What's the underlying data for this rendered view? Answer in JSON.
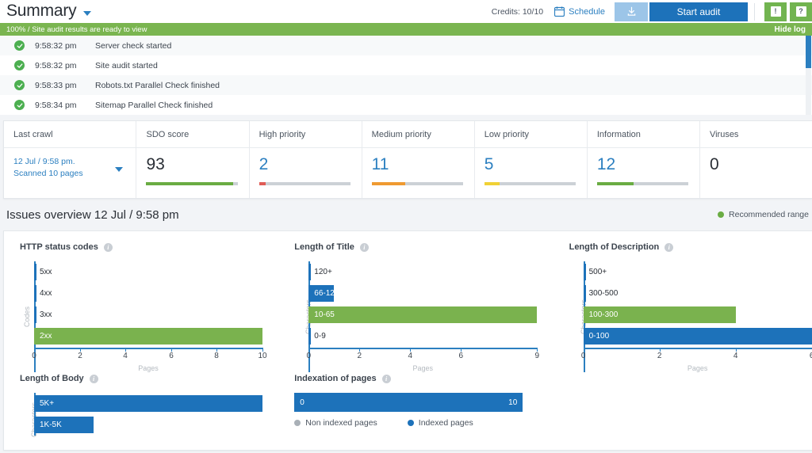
{
  "header": {
    "title": "Summary",
    "credits": "Credits: 10/10",
    "schedule_label": "Schedule",
    "export_icon": "export-icon",
    "start_audit_label": "Start audit",
    "feedback_glyph": "!",
    "help_glyph": "?"
  },
  "logbar": {
    "status": "100% / Site audit results are ready to view",
    "hide_log_label": "Hide log"
  },
  "log_rows": [
    {
      "time": "9:58:32 pm",
      "message": "Server check started"
    },
    {
      "time": "9:58:32 pm",
      "message": "Site audit started"
    },
    {
      "time": "9:58:33 pm",
      "message": "Robots.txt Parallel Check finished"
    },
    {
      "time": "9:58:34 pm",
      "message": "Sitemap Parallel Check finished"
    }
  ],
  "summary": {
    "columns": [
      {
        "header": "Last crawl",
        "line1": "12 Jul / 9:58 pm.",
        "line2": "Scanned 10 pages"
      },
      {
        "header": "SDO score",
        "value": "93",
        "meter_pct": 95,
        "meter_color": "#6aac43",
        "value_color": "dark"
      },
      {
        "header": "High priority",
        "value": "2",
        "meter_pct": 7,
        "meter_color": "#e05c56",
        "value_color": "blue"
      },
      {
        "header": "Medium priority",
        "value": "11",
        "meter_pct": 37,
        "meter_color": "#ef9a31",
        "value_color": "blue"
      },
      {
        "header": "Low priority",
        "value": "5",
        "meter_pct": 17,
        "meter_color": "#f0d135",
        "value_color": "blue"
      },
      {
        "header": "Information",
        "value": "12",
        "meter_pct": 40,
        "meter_color": "#6aac43",
        "value_color": "blue"
      },
      {
        "header": "Viruses",
        "value": "0",
        "meter_pct": 0,
        "meter_color": "#cccccc",
        "value_color": "dark"
      }
    ]
  },
  "issues": {
    "title": "Issues overview 12 Jul / 9:58 pm",
    "legend_label": "Recommended range",
    "legend_color": "#6aac43"
  },
  "colors": {
    "blue": "#1d72ba",
    "green": "#7ab24e",
    "grey": "#a9b0b7",
    "axis": "#2b7fc0"
  },
  "chart_data": [
    {
      "type": "bar",
      "orientation": "horizontal",
      "title": "HTTP status codes",
      "xlabel": "Pages",
      "ylabel": "Codes",
      "categories": [
        "5xx",
        "4xx",
        "3xx",
        "2xx"
      ],
      "values": [
        0,
        0,
        0,
        10
      ],
      "bar_colors": [
        "#1d72ba",
        "#1d72ba",
        "#1d72ba",
        "#7ab24e"
      ],
      "label_inside": [
        false,
        false,
        false,
        true
      ],
      "xlim": [
        0,
        10
      ],
      "xticks": [
        0,
        2,
        4,
        6,
        8,
        10
      ],
      "grid": false
    },
    {
      "type": "bar",
      "orientation": "horizontal",
      "title": "Length of Title",
      "xlabel": "Pages",
      "ylabel": "Characters",
      "categories": [
        "120+",
        "66-120",
        "10-65",
        "0-9"
      ],
      "values": [
        0,
        1,
        9,
        0
      ],
      "bar_colors": [
        "#1d72ba",
        "#1d72ba",
        "#7ab24e",
        "#1d72ba"
      ],
      "label_inside": [
        false,
        true,
        true,
        false
      ],
      "xlim": [
        0,
        9
      ],
      "xticks": [
        0,
        2,
        4,
        6,
        9
      ],
      "grid": false
    },
    {
      "type": "bar",
      "orientation": "horizontal",
      "title": "Length of Description",
      "xlabel": "Pages",
      "ylabel": "Characters",
      "categories": [
        "500+",
        "300-500",
        "100-300",
        "0-100"
      ],
      "values": [
        0,
        0,
        4,
        6
      ],
      "bar_colors": [
        "#1d72ba",
        "#1d72ba",
        "#7ab24e",
        "#1d72ba"
      ],
      "label_inside": [
        false,
        false,
        true,
        true
      ],
      "xlim": [
        0,
        6
      ],
      "xticks": [
        0,
        2,
        4,
        6
      ],
      "grid": false
    },
    {
      "type": "bar",
      "orientation": "horizontal",
      "title": "Length of Body",
      "xlabel": "",
      "ylabel": "Characters",
      "categories": [
        "5K+",
        "1K-5K"
      ],
      "values": [
        10,
        2.6
      ],
      "bar_colors": [
        "#1d72ba",
        "#1d72ba"
      ],
      "label_inside": [
        true,
        true
      ],
      "xlim": [
        0,
        10
      ],
      "clipped": true,
      "grid": false
    },
    {
      "type": "bar",
      "orientation": "stacked-horizontal",
      "title": "Indexation of pages",
      "xlabel": "",
      "ylabel": "",
      "segments": [
        {
          "name": "Non indexed pages",
          "value": 0,
          "color": "#a9b0b7",
          "label": "0"
        },
        {
          "name": "Indexed pages",
          "value": 10,
          "color": "#1d72ba",
          "label": "10"
        }
      ],
      "legend": [
        {
          "label": "Non indexed pages",
          "color": "#a9b0b7"
        },
        {
          "label": "Indexed pages",
          "color": "#1d72ba"
        }
      ],
      "total": 10,
      "grid": false
    }
  ]
}
